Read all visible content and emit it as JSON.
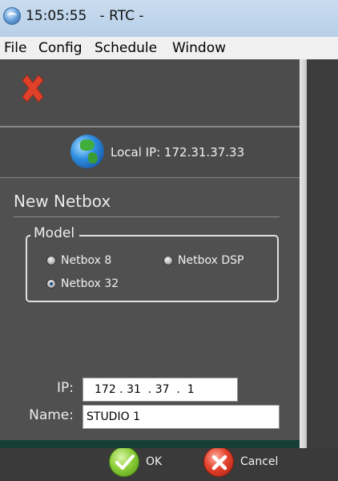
{
  "window": {
    "title": "15:05:55   - RTC -"
  },
  "menu": {
    "items": [
      "File",
      "Config",
      "Schedule",
      "Window"
    ]
  },
  "network": {
    "local_ip": "Local IP: 172.31.37.33"
  },
  "form": {
    "title": "New  Netbox",
    "model": {
      "legend": "Model",
      "options": [
        "Netbox 8",
        "Netbox DSP",
        "Netbox 32"
      ],
      "selected": "Netbox 32"
    },
    "ip_label": "IP:",
    "ip_value": "172 . 31  . 37  .  1",
    "name_label": "Name:",
    "name_value": "STUDIO 1",
    "ok_label": "OK",
    "cancel_label": "Cancel"
  },
  "colors": {
    "panel": "#505050",
    "accent_ok": "#8fce3a",
    "accent_cancel": "#e4442e",
    "close_x": "#e0412b"
  },
  "icons": [
    "app-globe-icon",
    "close-x-icon",
    "globe-icon",
    "checkmark-icon",
    "x-icon"
  ]
}
